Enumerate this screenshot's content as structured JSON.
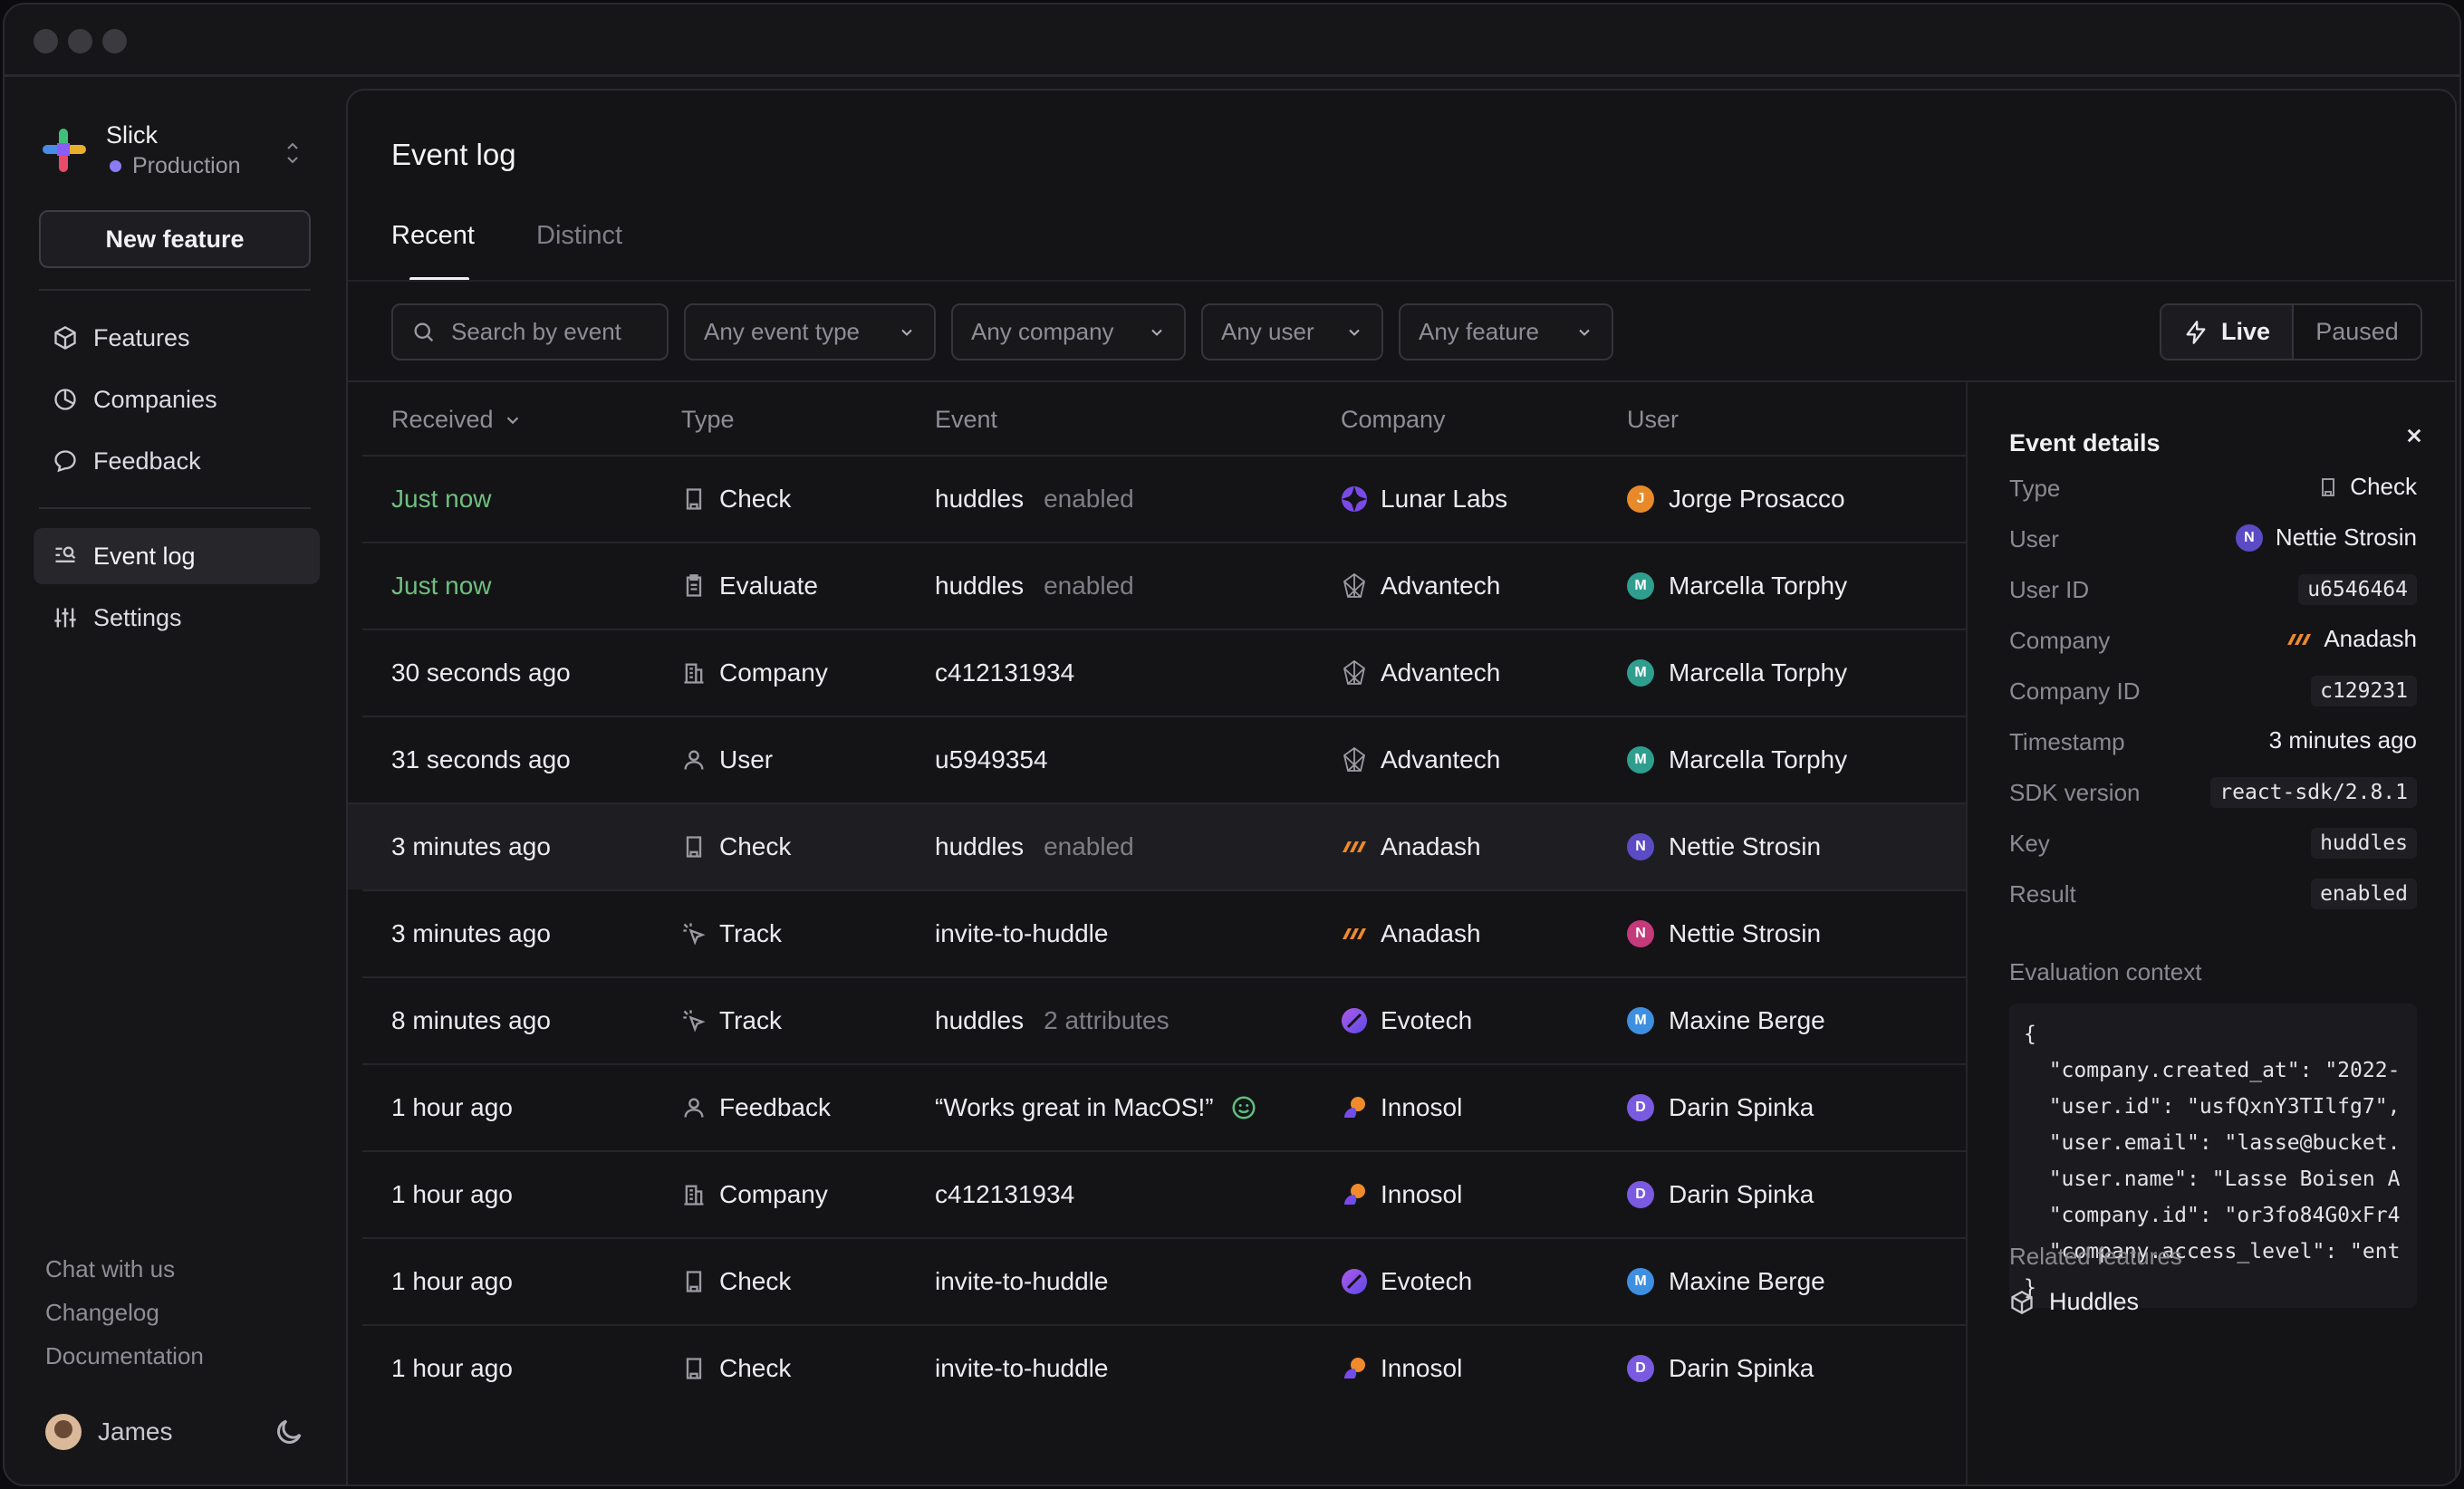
{
  "workspace": {
    "name": "Slick",
    "environment": "Production"
  },
  "sidebar": {
    "new_feature_label": "New feature",
    "nav": [
      {
        "label": "Features",
        "icon": "cube-icon"
      },
      {
        "label": "Companies",
        "icon": "pie-chart-icon"
      },
      {
        "label": "Feedback",
        "icon": "chat-bubble-icon"
      },
      {
        "label": "Event log",
        "icon": "log-search-icon",
        "active": true
      },
      {
        "label": "Settings",
        "icon": "sliders-icon"
      }
    ],
    "footer_links": [
      "Chat with us",
      "Changelog",
      "Documentation"
    ],
    "user_name": "James"
  },
  "page": {
    "title": "Event log",
    "tabs": [
      "Recent",
      "Distinct"
    ],
    "active_tab": "Recent"
  },
  "filters": {
    "search_placeholder": "Search by event",
    "event_type": "Any event type",
    "company": "Any company",
    "user": "Any user",
    "feature": "Any feature",
    "live_label": "Live",
    "paused_label": "Paused"
  },
  "table": {
    "columns": [
      "Received",
      "Type",
      "Event",
      "Company",
      "User"
    ],
    "rows": [
      {
        "received": "Just now",
        "recent": true,
        "type": "Check",
        "event": "huddles",
        "event_extra": "enabled",
        "company": "Lunar Labs",
        "user": "Jorge Prosacco",
        "user_initial": "J",
        "user_color": "#e8892a"
      },
      {
        "received": "Just now",
        "recent": true,
        "type": "Evaluate",
        "event": "huddles",
        "event_extra": "enabled",
        "company": "Advantech",
        "user": "Marcella Torphy",
        "user_initial": "M",
        "user_color": "#2f9e8f"
      },
      {
        "received": "30 seconds ago",
        "type": "Company",
        "event": "c412131934",
        "event_extra": "",
        "company": "Advantech",
        "user": "Marcella Torphy",
        "user_initial": "M",
        "user_color": "#2f9e8f"
      },
      {
        "received": "31 seconds ago",
        "type": "User",
        "event": "u5949354",
        "event_extra": "",
        "company": "Advantech",
        "user": "Marcella Torphy",
        "user_initial": "M",
        "user_color": "#2f9e8f"
      },
      {
        "received": "3 minutes ago",
        "type": "Check",
        "event": "huddles",
        "event_extra": "enabled",
        "company": "Anadash",
        "user": "Nettie Strosin",
        "user_initial": "N",
        "user_color": "#5b4bc4",
        "selected": true
      },
      {
        "received": "3 minutes ago",
        "type": "Track",
        "event": "invite-to-huddle",
        "event_extra": "",
        "company": "Anadash",
        "user": "Nettie Strosin",
        "user_initial": "N",
        "user_color": "#c43a7a"
      },
      {
        "received": "8 minutes ago",
        "type": "Track",
        "event": "huddles",
        "event_extra": "2 attributes",
        "company": "Evotech",
        "user": "Maxine Berge",
        "user_initial": "M",
        "user_color": "#3f8fe0"
      },
      {
        "received": "1 hour ago",
        "type": "Feedback",
        "event": "“Works great in MacOS!”",
        "event_extra": "",
        "smile": true,
        "company": "Innosol",
        "user": "Darin Spinka",
        "user_initial": "D",
        "user_color": "#7a5ae0"
      },
      {
        "received": "1 hour ago",
        "type": "Company",
        "event": "c412131934",
        "event_extra": "",
        "company": "Innosol",
        "user": "Darin Spinka",
        "user_initial": "D",
        "user_color": "#7a5ae0"
      },
      {
        "received": "1 hour ago",
        "type": "Check",
        "event": "invite-to-huddle",
        "event_extra": "",
        "company": "Evotech",
        "user": "Maxine Berge",
        "user_initial": "M",
        "user_color": "#3f8fe0"
      },
      {
        "received": "1 hour ago",
        "type": "Check",
        "event": "invite-to-huddle",
        "event_extra": "",
        "company": "Innosol",
        "user": "Darin Spinka",
        "user_initial": "D",
        "user_color": "#7a5ae0"
      }
    ]
  },
  "details": {
    "title": "Event details",
    "fields": {
      "type_label": "Type",
      "type": "Check",
      "user_label": "User",
      "user": "Nettie Strosin",
      "user_initial": "N",
      "user_id_label": "User ID",
      "user_id": "u6546464",
      "company_label": "Company",
      "company": "Anadash",
      "company_id_label": "Company ID",
      "company_id": "c129231",
      "timestamp_label": "Timestamp",
      "timestamp": "3 minutes ago",
      "sdk_label": "SDK version",
      "sdk": "react-sdk/2.8.1",
      "key_label": "Key",
      "key": "huddles",
      "result_label": "Result",
      "result": "enabled"
    },
    "context_label": "Evaluation context",
    "context_code": "{\n  \"company.created_at\": \"2022-\n  \"user.id\": \"usfQxnY3TIlfg7\",\n  \"user.email\": \"lasse@bucket.\n  \"user.name\": \"Lasse Boisen A\n  \"company.id\": \"or3fo84G0xFr4\n  \"company.access_level\": \"ent\n}",
    "related_label": "Related features",
    "related_feature": "Huddles"
  },
  "colors": {
    "recent": "#6fbf7f",
    "accent": "#8b7cf6"
  }
}
